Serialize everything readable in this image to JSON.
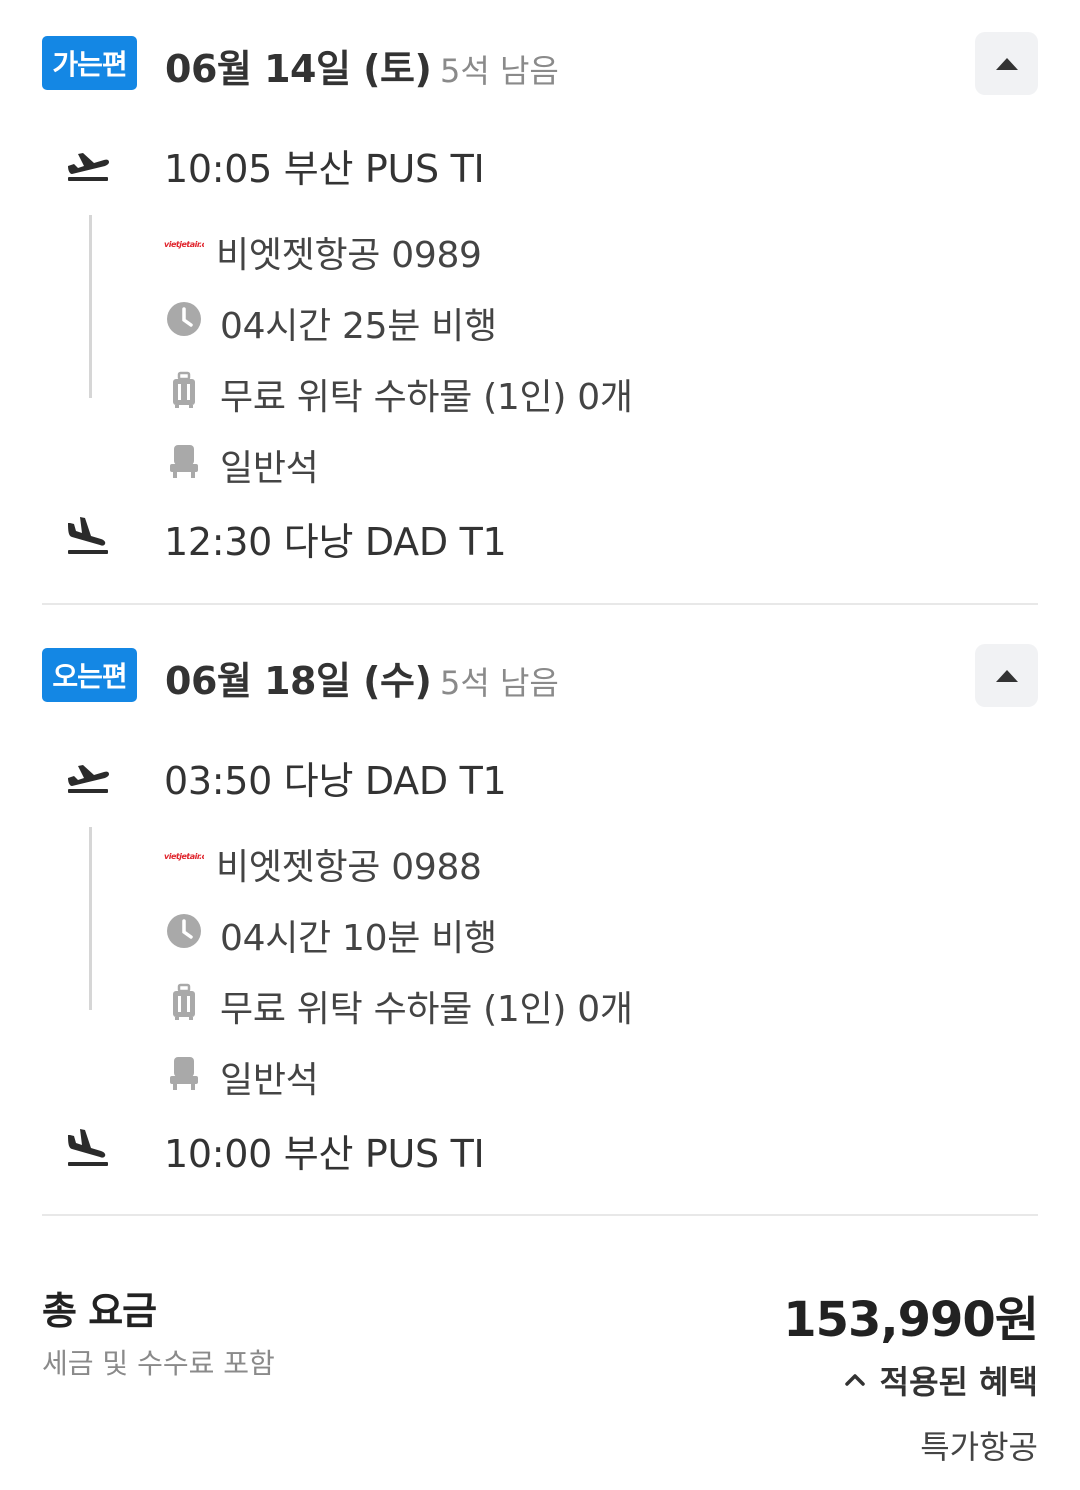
{
  "outbound": {
    "badge": "가는편",
    "date": "06월 14일 (토)",
    "seats": "5석 남음",
    "departure": "10:05 부산 PUS TI",
    "airline": "비엣젯항공 0989",
    "airline_logo_text": "vietjetair.com",
    "duration": "04시간 25분 비행",
    "baggage": "무료 위탁 수하물 (1인) 0개",
    "cabin": "일반석",
    "arrival": "12:30 다낭 DAD T1"
  },
  "return": {
    "badge": "오는편",
    "date": "06월 18일 (수)",
    "seats": "5석 남음",
    "departure": "03:50 다낭 DAD T1",
    "airline": "비엣젯항공 0988",
    "airline_logo_text": "vietjetair.com",
    "duration": "04시간 10분 비행",
    "baggage": "무료 위탁 수하물 (1인) 0개",
    "cabin": "일반석",
    "arrival": "10:00 부산 PUS TI"
  },
  "total": {
    "label": "총 요금",
    "sub": "세금 및 수수료 포함",
    "price": "153,990원",
    "benefit_label": "적용된 혜택",
    "benefit_item": "특가항공"
  },
  "colors": {
    "badge": "#1487e4",
    "airline_logo": "#e0262e",
    "icon": "#a9a9a9",
    "text_dark": "#333333",
    "text_muted": "#8a8a8a"
  },
  "icons": {
    "departure": "airplane-takeoff-icon",
    "arrival": "airplane-landing-icon",
    "duration": "clock-icon",
    "baggage": "luggage-icon",
    "cabin": "seat-icon",
    "collapse": "caret-up-icon",
    "benefit": "chevron-up-icon"
  }
}
